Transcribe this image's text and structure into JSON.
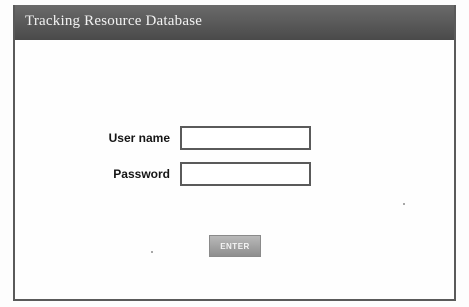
{
  "window": {
    "title": "Tracking Resource Database"
  },
  "login_form": {
    "username_label": "User name",
    "username_value": "",
    "password_label": "Password",
    "password_value": "",
    "enter_label": "ENTER"
  },
  "colors": {
    "title_bar": "#555555",
    "title_text": "#f2f2f2",
    "border": "#5a5a5a",
    "button": "#a5a5a5"
  }
}
